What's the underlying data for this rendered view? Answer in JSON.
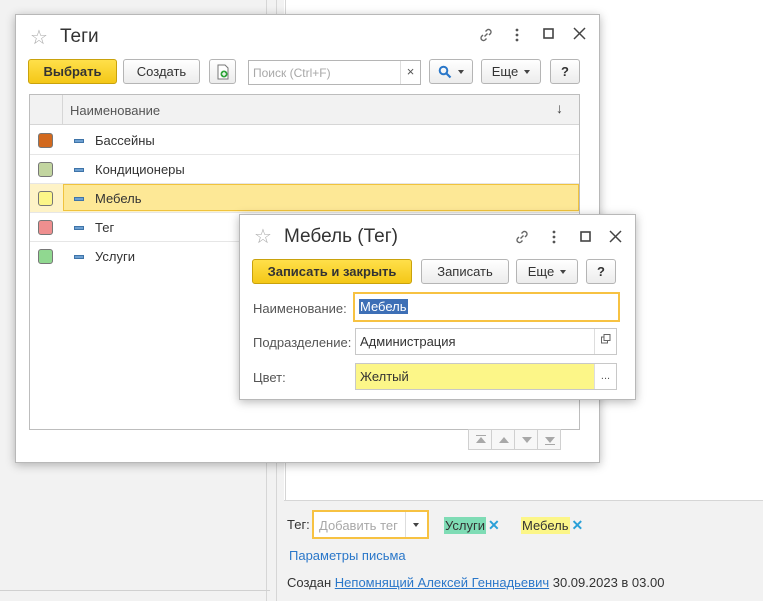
{
  "background": {
    "tag_label": "Тег:",
    "tag_placeholder": "Добавить тег",
    "tags": [
      {
        "label": "Услуги",
        "color": "#7fdcb5"
      },
      {
        "label": "Мебель",
        "color": "#fcf688"
      }
    ],
    "params_link": "Параметры письма",
    "created_prefix": "Создан",
    "created_author": "Непомнящий Алексей Геннадьевич",
    "created_date": "30.09.2023 в 03.00"
  },
  "tags_window": {
    "title": "Теги",
    "select_button": "Выбрать",
    "create_button": "Создать",
    "search_placeholder": "Поиск (Ctrl+F)",
    "search_clear": "×",
    "more_button": "Еще",
    "help_button": "?",
    "column_name": "Наименование",
    "sort_indicator": "↓",
    "rows": [
      {
        "name": "Бассейны",
        "color": "#d2691e"
      },
      {
        "name": "Кондиционеры",
        "color": "#c2d5a0"
      },
      {
        "name": "Мебель",
        "color": "#fcf688",
        "selected": true
      },
      {
        "name": "Тег",
        "color": "#ef8f8f"
      },
      {
        "name": "Услуги",
        "color": "#90d890"
      }
    ]
  },
  "item_window": {
    "title": "Мебель (Тег)",
    "save_close_button": "Записать и закрыть",
    "save_button": "Записать",
    "more_button": "Еще",
    "help_button": "?",
    "fields": {
      "name_label": "Наименование:",
      "name_value": "Мебель",
      "division_label": "Подразделение:",
      "division_value": "Администрация",
      "color_label": "Цвет:",
      "color_value": "Желтый",
      "color_button": "..."
    }
  },
  "colors": {
    "accent": "#f4c717",
    "link": "#2a77c9",
    "selection": "#fde896"
  }
}
